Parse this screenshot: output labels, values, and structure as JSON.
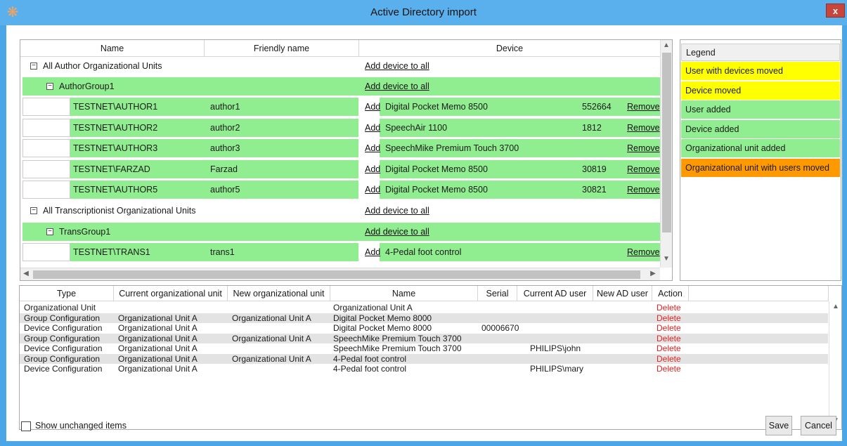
{
  "window": {
    "title": "Active Directory import",
    "close_label": "x",
    "app_icon": "asterisk-icon"
  },
  "tree": {
    "columns": [
      "Name",
      "Friendly name",
      "Device"
    ],
    "add_all_label": "Add device to all",
    "add_label": "Add",
    "remove_label": "Remove",
    "groups": [
      {
        "label": "All Author Organizational Units"
      },
      {
        "label": "AuthorGroup1"
      },
      {
        "label": "All Transcriptionist Organizational Units"
      },
      {
        "label": "TransGroup1"
      }
    ],
    "authors": [
      {
        "name": "TESTNET\\AUTHOR1",
        "friendly": "author1",
        "device": "Digital Pocket Memo 8500",
        "serial": "552664"
      },
      {
        "name": "TESTNET\\AUTHOR2",
        "friendly": "author2",
        "device": "SpeechAir 1100",
        "serial": "1812"
      },
      {
        "name": "TESTNET\\AUTHOR3",
        "friendly": "author3",
        "device": "SpeechMike Premium Touch 3700",
        "serial": ""
      },
      {
        "name": "TESTNET\\FARZAD",
        "friendly": "Farzad",
        "device": "Digital Pocket Memo 8500",
        "serial": "30819"
      },
      {
        "name": "TESTNET\\AUTHOR5",
        "friendly": "author5",
        "device": "Digital Pocket Memo 8500",
        "serial": "30821"
      }
    ],
    "trans": [
      {
        "name": "TESTNET\\TRANS1",
        "friendly": "trans1",
        "device": "4-Pedal foot control",
        "serial": ""
      }
    ]
  },
  "legend": {
    "title": "Legend",
    "items": [
      {
        "label": "User with devices moved",
        "color": "#ffff00"
      },
      {
        "label": "Device moved",
        "color": "#ffff00"
      },
      {
        "label": "User added",
        "color": "#90ee90"
      },
      {
        "label": "Device added",
        "color": "#90ee90"
      },
      {
        "label": "Organizational unit added",
        "color": "#90ee90"
      },
      {
        "label": "Organizational unit with users moved",
        "color": "#ff9900"
      }
    ]
  },
  "changes": {
    "columns": [
      "Type",
      "Current organizational unit",
      "New organizational unit",
      "Name",
      "Serial",
      "Current AD user",
      "New AD user",
      "Action"
    ],
    "rows": [
      {
        "type": "Organizational Unit",
        "current_ou": "",
        "new_ou": "",
        "name": "Organizational Unit A",
        "serial": "",
        "current_user": "",
        "new_user": "",
        "action": "Delete"
      },
      {
        "type": "Group Configuration",
        "current_ou": "Organizational Unit A",
        "new_ou": "Organizational Unit A",
        "name": "Digital Pocket Memo 8000",
        "serial": "",
        "current_user": "",
        "new_user": "",
        "action": "Delete"
      },
      {
        "type": "Device Configuration",
        "current_ou": "Organizational Unit A",
        "new_ou": "",
        "name": "Digital Pocket Memo 8000",
        "serial": "00006670",
        "current_user": "",
        "new_user": "",
        "action": "Delete"
      },
      {
        "type": "Group Configuration",
        "current_ou": "Organizational Unit A",
        "new_ou": "Organizational Unit A",
        "name": "SpeechMike Premium Touch 3700",
        "serial": "",
        "current_user": "",
        "new_user": "",
        "action": "Delete"
      },
      {
        "type": "Device Configuration",
        "current_ou": "Organizational Unit A",
        "new_ou": "",
        "name": "SpeechMike Premium Touch 3700",
        "serial": "",
        "current_user": "PHILIPS\\john",
        "new_user": "",
        "action": "Delete"
      },
      {
        "type": "Group Configuration",
        "current_ou": "Organizational Unit A",
        "new_ou": "Organizational Unit A",
        "name": "4-Pedal foot control",
        "serial": "",
        "current_user": "",
        "new_user": "",
        "action": "Delete"
      },
      {
        "type": "Device Configuration",
        "current_ou": "Organizational Unit A",
        "new_ou": "",
        "name": "4-Pedal foot control",
        "serial": "",
        "current_user": "PHILIPS\\mary",
        "new_user": "",
        "action": "Delete"
      }
    ]
  },
  "footer": {
    "show_unchanged_label": "Show unchanged items",
    "save_label": "Save",
    "cancel_label": "Cancel"
  }
}
